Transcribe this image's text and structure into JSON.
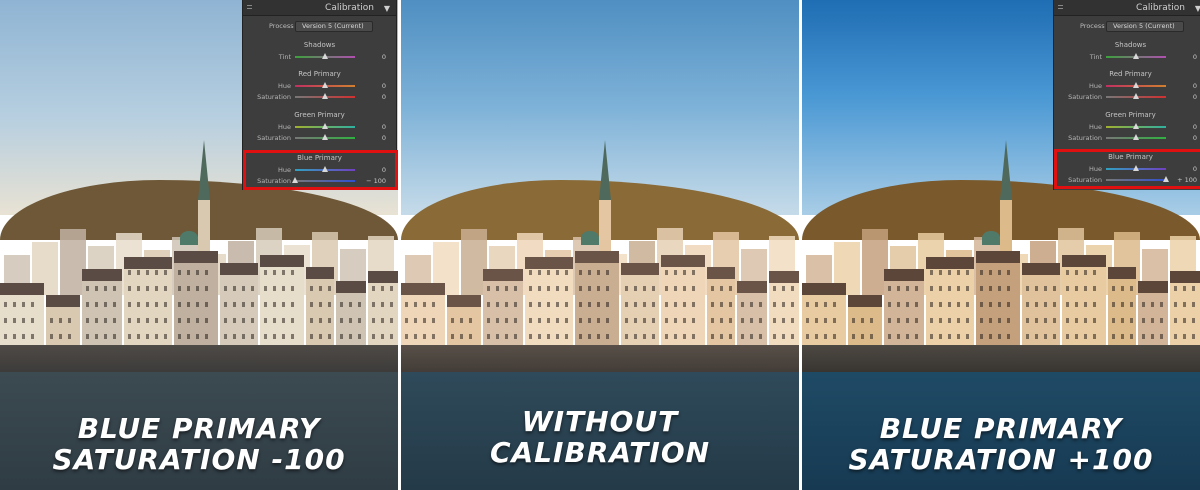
{
  "panels": [
    {
      "caption_line1": "BLUE PRIMARY",
      "caption_line2": "SATURATION -100"
    },
    {
      "caption_line1": "WITHOUT",
      "caption_line2": "CALIBRATION"
    },
    {
      "caption_line1": "BLUE PRIMARY",
      "caption_line2": "SATURATION +100"
    }
  ],
  "calibration_panel": {
    "title": "Calibration",
    "process_label": "Process :",
    "process_value": "Version 5 (Current)",
    "shadows": "Shadows",
    "tint": "Tint",
    "red_primary": "Red Primary",
    "green_primary": "Green Primary",
    "blue_primary": "Blue Primary",
    "hue": "Hue",
    "saturation": "Saturation",
    "zero": "0"
  },
  "left_panel": {
    "blue_saturation": "− 100",
    "blue_saturation_level": -100
  },
  "right_panel": {
    "blue_saturation": "+ 100",
    "blue_saturation_level": 100
  },
  "colors": {
    "highlight": "#e01010",
    "panel_bg": "#3d3d3d"
  }
}
